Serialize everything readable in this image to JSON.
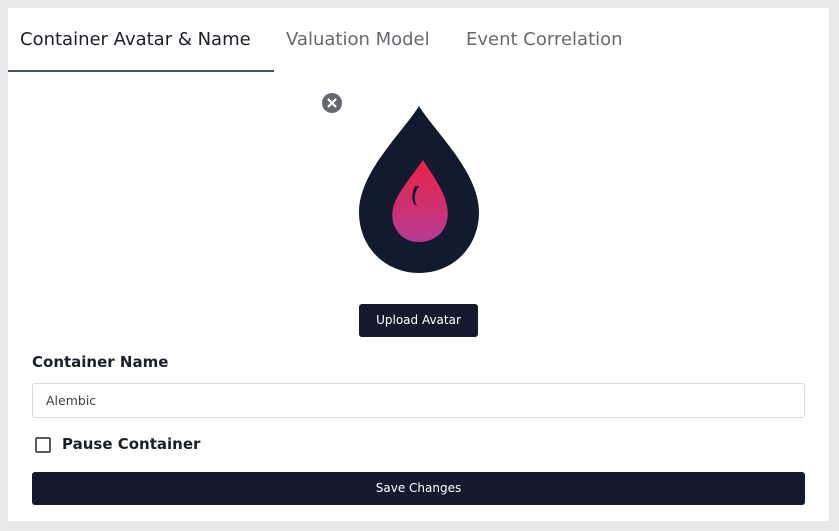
{
  "tabs": [
    {
      "label": "Container Avatar & Name",
      "active": true
    },
    {
      "label": "Valuation Model",
      "active": false
    },
    {
      "label": "Event Correlation",
      "active": false
    }
  ],
  "avatar": {
    "icon": "flame-drop-icon",
    "drop_color": "#121a2e",
    "flame_colors": [
      "#e8234f",
      "#b73a8f"
    ],
    "remove_icon": "close-circle-icon",
    "upload_label": "Upload Avatar"
  },
  "form": {
    "name_label": "Container Name",
    "name_value": "Alembic",
    "pause_label": "Pause Container",
    "pause_checked": false,
    "save_label": "Save Changes"
  },
  "colors": {
    "primary": "#131a2e",
    "active_tab_underline": "#4a5160"
  }
}
